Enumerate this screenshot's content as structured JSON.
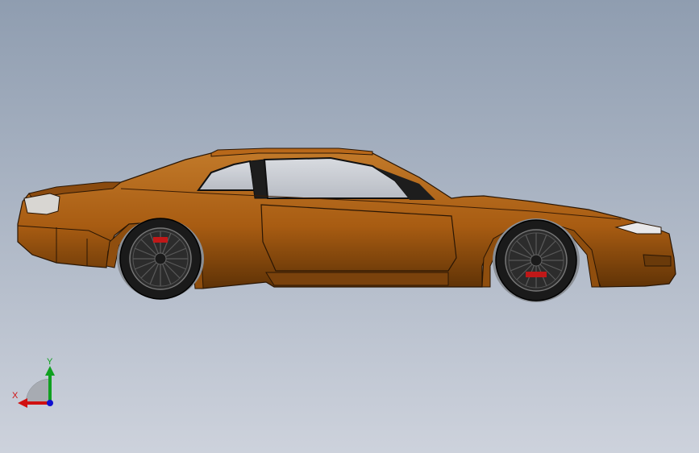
{
  "viewport": {
    "background_top": "#8f9db0",
    "background_bottom": "#cdd2dc"
  },
  "model": {
    "name": "car-model",
    "body_color": "#a85c12",
    "body_light": "#c27a2a",
    "body_dark": "#5e3206",
    "glass_color": "#c8ccd2",
    "tire_color": "#1a1a1a",
    "rim_color": "#3a3a3a",
    "caliper_color": "#c01818"
  },
  "triad": {
    "x_label": "X",
    "y_label": "Y",
    "x_color": "#d01010",
    "y_color": "#10a020",
    "z_color": "#1010d0"
  }
}
